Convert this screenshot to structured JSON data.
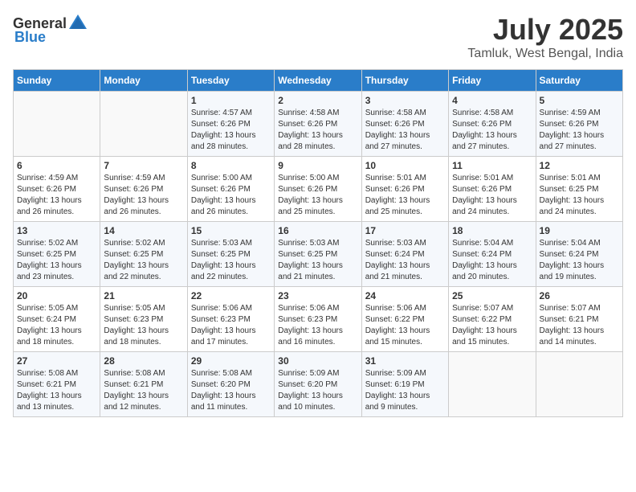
{
  "header": {
    "logo": {
      "general": "General",
      "blue": "Blue"
    },
    "title": "July 2025",
    "location": "Tamluk, West Bengal, India"
  },
  "weekdays": [
    "Sunday",
    "Monday",
    "Tuesday",
    "Wednesday",
    "Thursday",
    "Friday",
    "Saturday"
  ],
  "weeks": [
    [
      {
        "day": "",
        "info": ""
      },
      {
        "day": "",
        "info": ""
      },
      {
        "day": "1",
        "sunrise": "Sunrise: 4:57 AM",
        "sunset": "Sunset: 6:26 PM",
        "daylight": "Daylight: 13 hours and 28 minutes."
      },
      {
        "day": "2",
        "sunrise": "Sunrise: 4:58 AM",
        "sunset": "Sunset: 6:26 PM",
        "daylight": "Daylight: 13 hours and 28 minutes."
      },
      {
        "day": "3",
        "sunrise": "Sunrise: 4:58 AM",
        "sunset": "Sunset: 6:26 PM",
        "daylight": "Daylight: 13 hours and 27 minutes."
      },
      {
        "day": "4",
        "sunrise": "Sunrise: 4:58 AM",
        "sunset": "Sunset: 6:26 PM",
        "daylight": "Daylight: 13 hours and 27 minutes."
      },
      {
        "day": "5",
        "sunrise": "Sunrise: 4:59 AM",
        "sunset": "Sunset: 6:26 PM",
        "daylight": "Daylight: 13 hours and 27 minutes."
      }
    ],
    [
      {
        "day": "6",
        "sunrise": "Sunrise: 4:59 AM",
        "sunset": "Sunset: 6:26 PM",
        "daylight": "Daylight: 13 hours and 26 minutes."
      },
      {
        "day": "7",
        "sunrise": "Sunrise: 4:59 AM",
        "sunset": "Sunset: 6:26 PM",
        "daylight": "Daylight: 13 hours and 26 minutes."
      },
      {
        "day": "8",
        "sunrise": "Sunrise: 5:00 AM",
        "sunset": "Sunset: 6:26 PM",
        "daylight": "Daylight: 13 hours and 26 minutes."
      },
      {
        "day": "9",
        "sunrise": "Sunrise: 5:00 AM",
        "sunset": "Sunset: 6:26 PM",
        "daylight": "Daylight: 13 hours and 25 minutes."
      },
      {
        "day": "10",
        "sunrise": "Sunrise: 5:01 AM",
        "sunset": "Sunset: 6:26 PM",
        "daylight": "Daylight: 13 hours and 25 minutes."
      },
      {
        "day": "11",
        "sunrise": "Sunrise: 5:01 AM",
        "sunset": "Sunset: 6:26 PM",
        "daylight": "Daylight: 13 hours and 24 minutes."
      },
      {
        "day": "12",
        "sunrise": "Sunrise: 5:01 AM",
        "sunset": "Sunset: 6:25 PM",
        "daylight": "Daylight: 13 hours and 24 minutes."
      }
    ],
    [
      {
        "day": "13",
        "sunrise": "Sunrise: 5:02 AM",
        "sunset": "Sunset: 6:25 PM",
        "daylight": "Daylight: 13 hours and 23 minutes."
      },
      {
        "day": "14",
        "sunrise": "Sunrise: 5:02 AM",
        "sunset": "Sunset: 6:25 PM",
        "daylight": "Daylight: 13 hours and 22 minutes."
      },
      {
        "day": "15",
        "sunrise": "Sunrise: 5:03 AM",
        "sunset": "Sunset: 6:25 PM",
        "daylight": "Daylight: 13 hours and 22 minutes."
      },
      {
        "day": "16",
        "sunrise": "Sunrise: 5:03 AM",
        "sunset": "Sunset: 6:25 PM",
        "daylight": "Daylight: 13 hours and 21 minutes."
      },
      {
        "day": "17",
        "sunrise": "Sunrise: 5:03 AM",
        "sunset": "Sunset: 6:24 PM",
        "daylight": "Daylight: 13 hours and 21 minutes."
      },
      {
        "day": "18",
        "sunrise": "Sunrise: 5:04 AM",
        "sunset": "Sunset: 6:24 PM",
        "daylight": "Daylight: 13 hours and 20 minutes."
      },
      {
        "day": "19",
        "sunrise": "Sunrise: 5:04 AM",
        "sunset": "Sunset: 6:24 PM",
        "daylight": "Daylight: 13 hours and 19 minutes."
      }
    ],
    [
      {
        "day": "20",
        "sunrise": "Sunrise: 5:05 AM",
        "sunset": "Sunset: 6:24 PM",
        "daylight": "Daylight: 13 hours and 18 minutes."
      },
      {
        "day": "21",
        "sunrise": "Sunrise: 5:05 AM",
        "sunset": "Sunset: 6:23 PM",
        "daylight": "Daylight: 13 hours and 18 minutes."
      },
      {
        "day": "22",
        "sunrise": "Sunrise: 5:06 AM",
        "sunset": "Sunset: 6:23 PM",
        "daylight": "Daylight: 13 hours and 17 minutes."
      },
      {
        "day": "23",
        "sunrise": "Sunrise: 5:06 AM",
        "sunset": "Sunset: 6:23 PM",
        "daylight": "Daylight: 13 hours and 16 minutes."
      },
      {
        "day": "24",
        "sunrise": "Sunrise: 5:06 AM",
        "sunset": "Sunset: 6:22 PM",
        "daylight": "Daylight: 13 hours and 15 minutes."
      },
      {
        "day": "25",
        "sunrise": "Sunrise: 5:07 AM",
        "sunset": "Sunset: 6:22 PM",
        "daylight": "Daylight: 13 hours and 15 minutes."
      },
      {
        "day": "26",
        "sunrise": "Sunrise: 5:07 AM",
        "sunset": "Sunset: 6:21 PM",
        "daylight": "Daylight: 13 hours and 14 minutes."
      }
    ],
    [
      {
        "day": "27",
        "sunrise": "Sunrise: 5:08 AM",
        "sunset": "Sunset: 6:21 PM",
        "daylight": "Daylight: 13 hours and 13 minutes."
      },
      {
        "day": "28",
        "sunrise": "Sunrise: 5:08 AM",
        "sunset": "Sunset: 6:21 PM",
        "daylight": "Daylight: 13 hours and 12 minutes."
      },
      {
        "day": "29",
        "sunrise": "Sunrise: 5:08 AM",
        "sunset": "Sunset: 6:20 PM",
        "daylight": "Daylight: 13 hours and 11 minutes."
      },
      {
        "day": "30",
        "sunrise": "Sunrise: 5:09 AM",
        "sunset": "Sunset: 6:20 PM",
        "daylight": "Daylight: 13 hours and 10 minutes."
      },
      {
        "day": "31",
        "sunrise": "Sunrise: 5:09 AM",
        "sunset": "Sunset: 6:19 PM",
        "daylight": "Daylight: 13 hours and 9 minutes."
      },
      {
        "day": "",
        "info": ""
      },
      {
        "day": "",
        "info": ""
      }
    ]
  ]
}
